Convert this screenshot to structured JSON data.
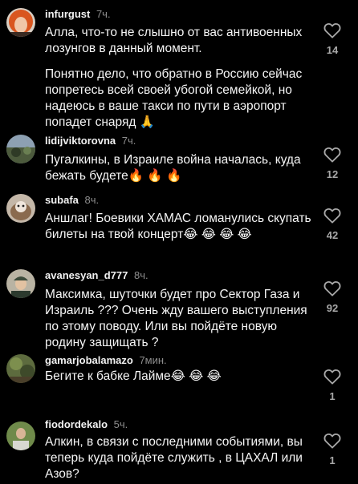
{
  "comments": [
    {
      "username": "infurgust",
      "time": "7ч.",
      "paragraphs": [
        "Алла, что-то не слышно от вас антивоенных лозунгов в данный момент.",
        "Понятно дело, что обратно в Россию сейчас попретесь всей своей убогой семейкой, но надеюсь в ваше такси по пути в аэропорт попадет снаряд 🙏"
      ],
      "likes": "14",
      "avatar_icon": "orange-haired-woman-avatar"
    },
    {
      "username": "lidijviktorovna",
      "time": "7ч.",
      "text": "Пугалкины, в Израиле война началась, куда бежать будете🔥 🔥 🔥",
      "likes": "12",
      "avatar_icon": "landscape-photo-avatar"
    },
    {
      "username": "subafa",
      "time": "8ч.",
      "text": "Аншлаг! Боевики ХАМАС ломанулись скупать билеты на твой концерт😂 😂 😂 😂",
      "likes": "42",
      "avatar_icon": "dog-photo-avatar"
    },
    {
      "username": "avanesyan_d777",
      "time": "8ч.",
      "text": "Максимка, шуточки будет про Сектор Газа и Израиль ??? Очень жду вашего выступления по этому поводу. Или вы пойдёте новую родину защищать ?",
      "likes": "92",
      "avatar_icon": "man-in-cap-avatar"
    },
    {
      "username": "gamarjobalamazo",
      "time": "7мин.",
      "text": "Бегите к бабке Лайме😂 😂 😂",
      "likes": "1",
      "avatar_icon": "nature-photo-avatar"
    },
    {
      "username": "fiodordekalo",
      "time": "5ч.",
      "text": "Алкин, в связи с последними событиями, вы теперь куда пойдёте служить , в ЦАХАЛ или Азов?",
      "likes": "1",
      "avatar_icon": "man-outdoors-avatar"
    }
  ]
}
